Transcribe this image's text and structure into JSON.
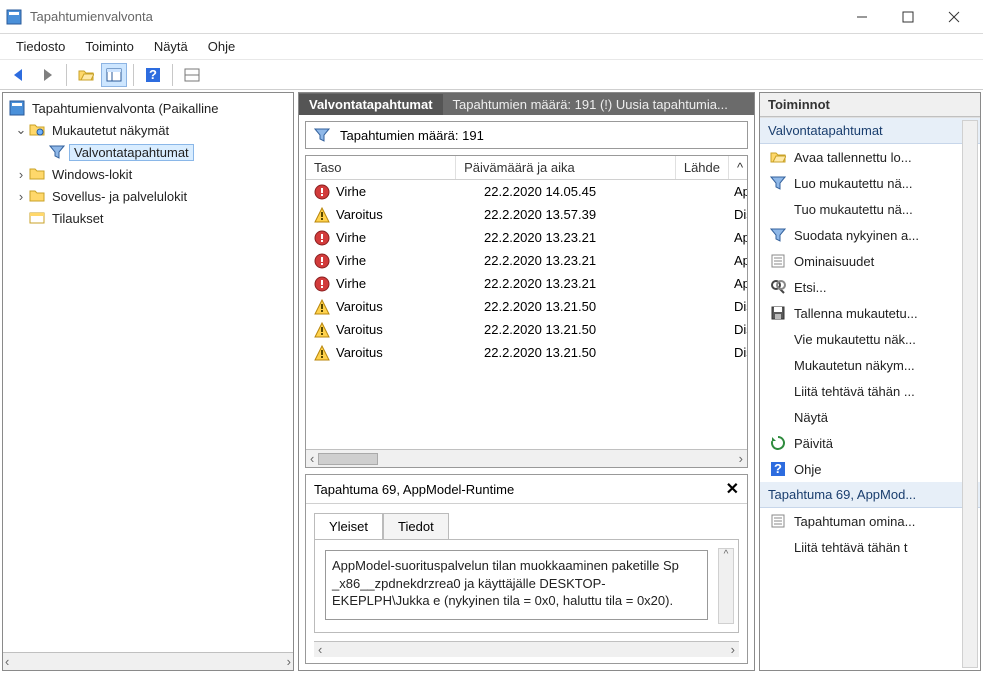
{
  "window": {
    "title": "Tapahtumienvalvonta"
  },
  "menu": {
    "file": "Tiedosto",
    "action": "Toiminto",
    "view": "Näytä",
    "help": "Ohje"
  },
  "tree": {
    "root": "Tapahtumienvalvonta (Paikalline",
    "custom_views": "Mukautetut näkymät",
    "admin_events": "Valvontatapahtumat",
    "windows_logs": "Windows-lokit",
    "app_service_logs": "Sovellus- ja palvelulokit",
    "subscriptions": "Tilaukset"
  },
  "center": {
    "header_title": "Valvontatapahtumat",
    "header_sub": "Tapahtumien määrä: 191 (!) Uusia tapahtumia...",
    "filter_summary": "Tapahtumien määrä: 191",
    "cols": {
      "level": "Taso",
      "date": "Päivämäärä ja aika",
      "source": "Lähde"
    },
    "rows": [
      {
        "level": "Virhe",
        "icon": "error",
        "date": "22.2.2020 14.05.45",
        "source": "AppM"
      },
      {
        "level": "Varoitus",
        "icon": "warning",
        "date": "22.2.2020 13.57.39",
        "source": "Distrib"
      },
      {
        "level": "Virhe",
        "icon": "error",
        "date": "22.2.2020 13.23.21",
        "source": "AppM"
      },
      {
        "level": "Virhe",
        "icon": "error",
        "date": "22.2.2020 13.23.21",
        "source": "AppM"
      },
      {
        "level": "Virhe",
        "icon": "error",
        "date": "22.2.2020 13.23.21",
        "source": "AppM"
      },
      {
        "level": "Varoitus",
        "icon": "warning",
        "date": "22.2.2020 13.21.50",
        "source": "Distrib"
      },
      {
        "level": "Varoitus",
        "icon": "warning",
        "date": "22.2.2020 13.21.50",
        "source": "Distrib"
      },
      {
        "level": "Varoitus",
        "icon": "warning",
        "date": "22.2.2020 13.21.50",
        "source": "Distrib"
      }
    ],
    "details": {
      "title": "Tapahtuma 69, AppModel-Runtime",
      "tabs": {
        "general": "Yleiset",
        "details": "Tiedot"
      },
      "description": "AppModel-suorituspalvelun tilan muokkaaminen paketille Sp _x86__zpdnekdrzrea0 ja käyttäjälle DESKTOP-EKEPLPH\\Jukka e (nykyinen tila = 0x0, haluttu tila = 0x20)."
    }
  },
  "actions": {
    "header": "Toiminnot",
    "group1": {
      "title": "Valvontatapahtumat",
      "items": [
        {
          "icon": "open",
          "label": "Avaa tallennettu lo..."
        },
        {
          "icon": "filter",
          "label": "Luo mukautettu nä..."
        },
        {
          "icon": "none",
          "label": "Tuo mukautettu nä..."
        },
        {
          "icon": "filter",
          "label": "Suodata nykyinen a..."
        },
        {
          "icon": "props",
          "label": "Ominaisuudet"
        },
        {
          "icon": "find",
          "label": "Etsi..."
        },
        {
          "icon": "save",
          "label": "Tallenna mukautetu..."
        },
        {
          "icon": "none",
          "label": "Vie mukautettu näk..."
        },
        {
          "icon": "none",
          "label": "Mukautetun näkym..."
        },
        {
          "icon": "none",
          "label": "Liitä tehtävä tähän ..."
        },
        {
          "icon": "none",
          "label": "Näytä",
          "sub": true
        },
        {
          "icon": "refresh",
          "label": "Päivitä"
        },
        {
          "icon": "help",
          "label": "Ohje",
          "sub": true
        }
      ]
    },
    "group2": {
      "title": "Tapahtuma 69, AppMod...",
      "items": [
        {
          "icon": "props",
          "label": "Tapahtuman omina..."
        },
        {
          "icon": "none",
          "label": "Liitä tehtävä tähän t"
        }
      ]
    }
  }
}
